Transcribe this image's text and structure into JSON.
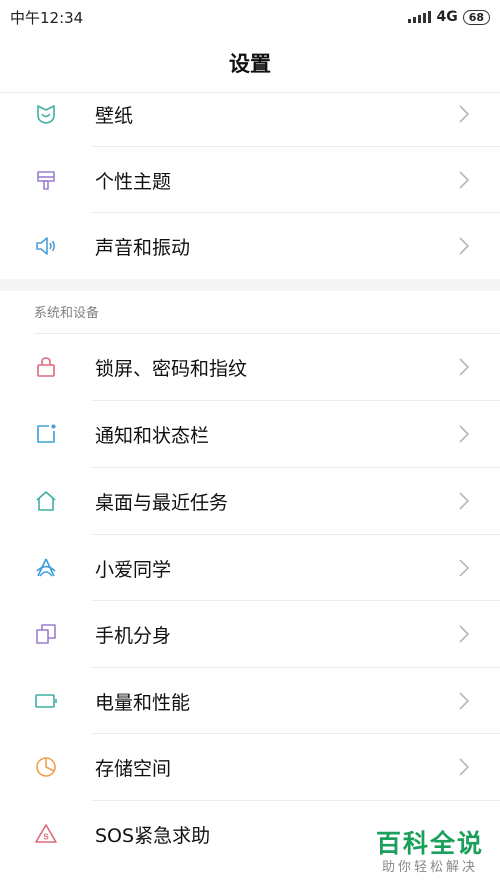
{
  "status_bar": {
    "time": "中午12:34",
    "network": "4G",
    "battery": "68"
  },
  "header": {
    "title": "设置"
  },
  "top_items": [
    {
      "label": "壁纸",
      "icon": "wallpaper-icon",
      "color": "#3fb0a2"
    },
    {
      "label": "个性主题",
      "icon": "theme-brush-icon",
      "color": "#9a7fd1"
    },
    {
      "label": "声音和振动",
      "icon": "speaker-icon",
      "color": "#4a9fd9"
    }
  ],
  "section": {
    "title": "系统和设备",
    "items": [
      {
        "label": "锁屏、密码和指纹",
        "icon": "lock-icon",
        "color": "#e06a7a"
      },
      {
        "label": "通知和状态栏",
        "icon": "notification-icon",
        "color": "#3d9fdc"
      },
      {
        "label": "桌面与最近任务",
        "icon": "home-icon",
        "color": "#3fb0a2"
      },
      {
        "label": "小爱同学",
        "icon": "xiaoai-icon",
        "color": "#3d9fdc"
      },
      {
        "label": "手机分身",
        "icon": "second-space-icon",
        "color": "#9a7fd1"
      },
      {
        "label": "电量和性能",
        "icon": "battery-icon",
        "color": "#3fb0a2"
      },
      {
        "label": "存储空间",
        "icon": "storage-pie-icon",
        "color": "#f0a050"
      },
      {
        "label": "SOS紧急求助",
        "icon": "sos-icon",
        "color": "#e06a7a"
      }
    ]
  },
  "watermark": {
    "title": "百科全说",
    "subtitle": "助你轻松解决"
  }
}
